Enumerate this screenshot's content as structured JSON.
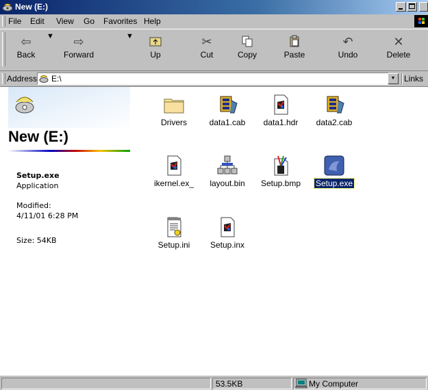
{
  "window": {
    "title": "New (E:)"
  },
  "menu": {
    "items": [
      "File",
      "Edit",
      "View",
      "Go",
      "Favorites",
      "Help"
    ]
  },
  "toolbar": {
    "back": "Back",
    "forward": "Forward",
    "up": "Up",
    "cut": "Cut",
    "copy": "Copy",
    "paste": "Paste",
    "undo": "Undo",
    "delete": "Delete"
  },
  "address": {
    "label": "Address",
    "value": "E:\\",
    "links": "Links"
  },
  "panel": {
    "title": "New (E:)",
    "selected_name": "Setup.exe",
    "selected_type": "Application",
    "modified_label": "Modified:",
    "modified_value": "4/11/01 6:28 PM",
    "size": "Size: 54KB"
  },
  "files": [
    {
      "name": "Drivers",
      "icon": "folder-icon"
    },
    {
      "name": "data1.cab",
      "icon": "cabinet-icon"
    },
    {
      "name": "data1.hdr",
      "icon": "installshield-file-icon"
    },
    {
      "name": "data2.cab",
      "icon": "cabinet-icon"
    },
    {
      "name": "ikernel.ex_",
      "icon": "installshield-file-icon"
    },
    {
      "name": "layout.bin",
      "icon": "network-file-icon"
    },
    {
      "name": "Setup.bmp",
      "icon": "paint-file-icon"
    },
    {
      "name": "Setup.exe",
      "icon": "setup-application-icon",
      "selected": true
    },
    {
      "name": "Setup.ini",
      "icon": "config-file-icon"
    },
    {
      "name": "Setup.inx",
      "icon": "installshield-file-icon"
    }
  ],
  "status": {
    "size": "53.5KB",
    "zone": "My Computer"
  },
  "colors": {
    "titlebar": "#0a246a",
    "selection": "#0a246a",
    "chrome": "#c0c0c0"
  }
}
